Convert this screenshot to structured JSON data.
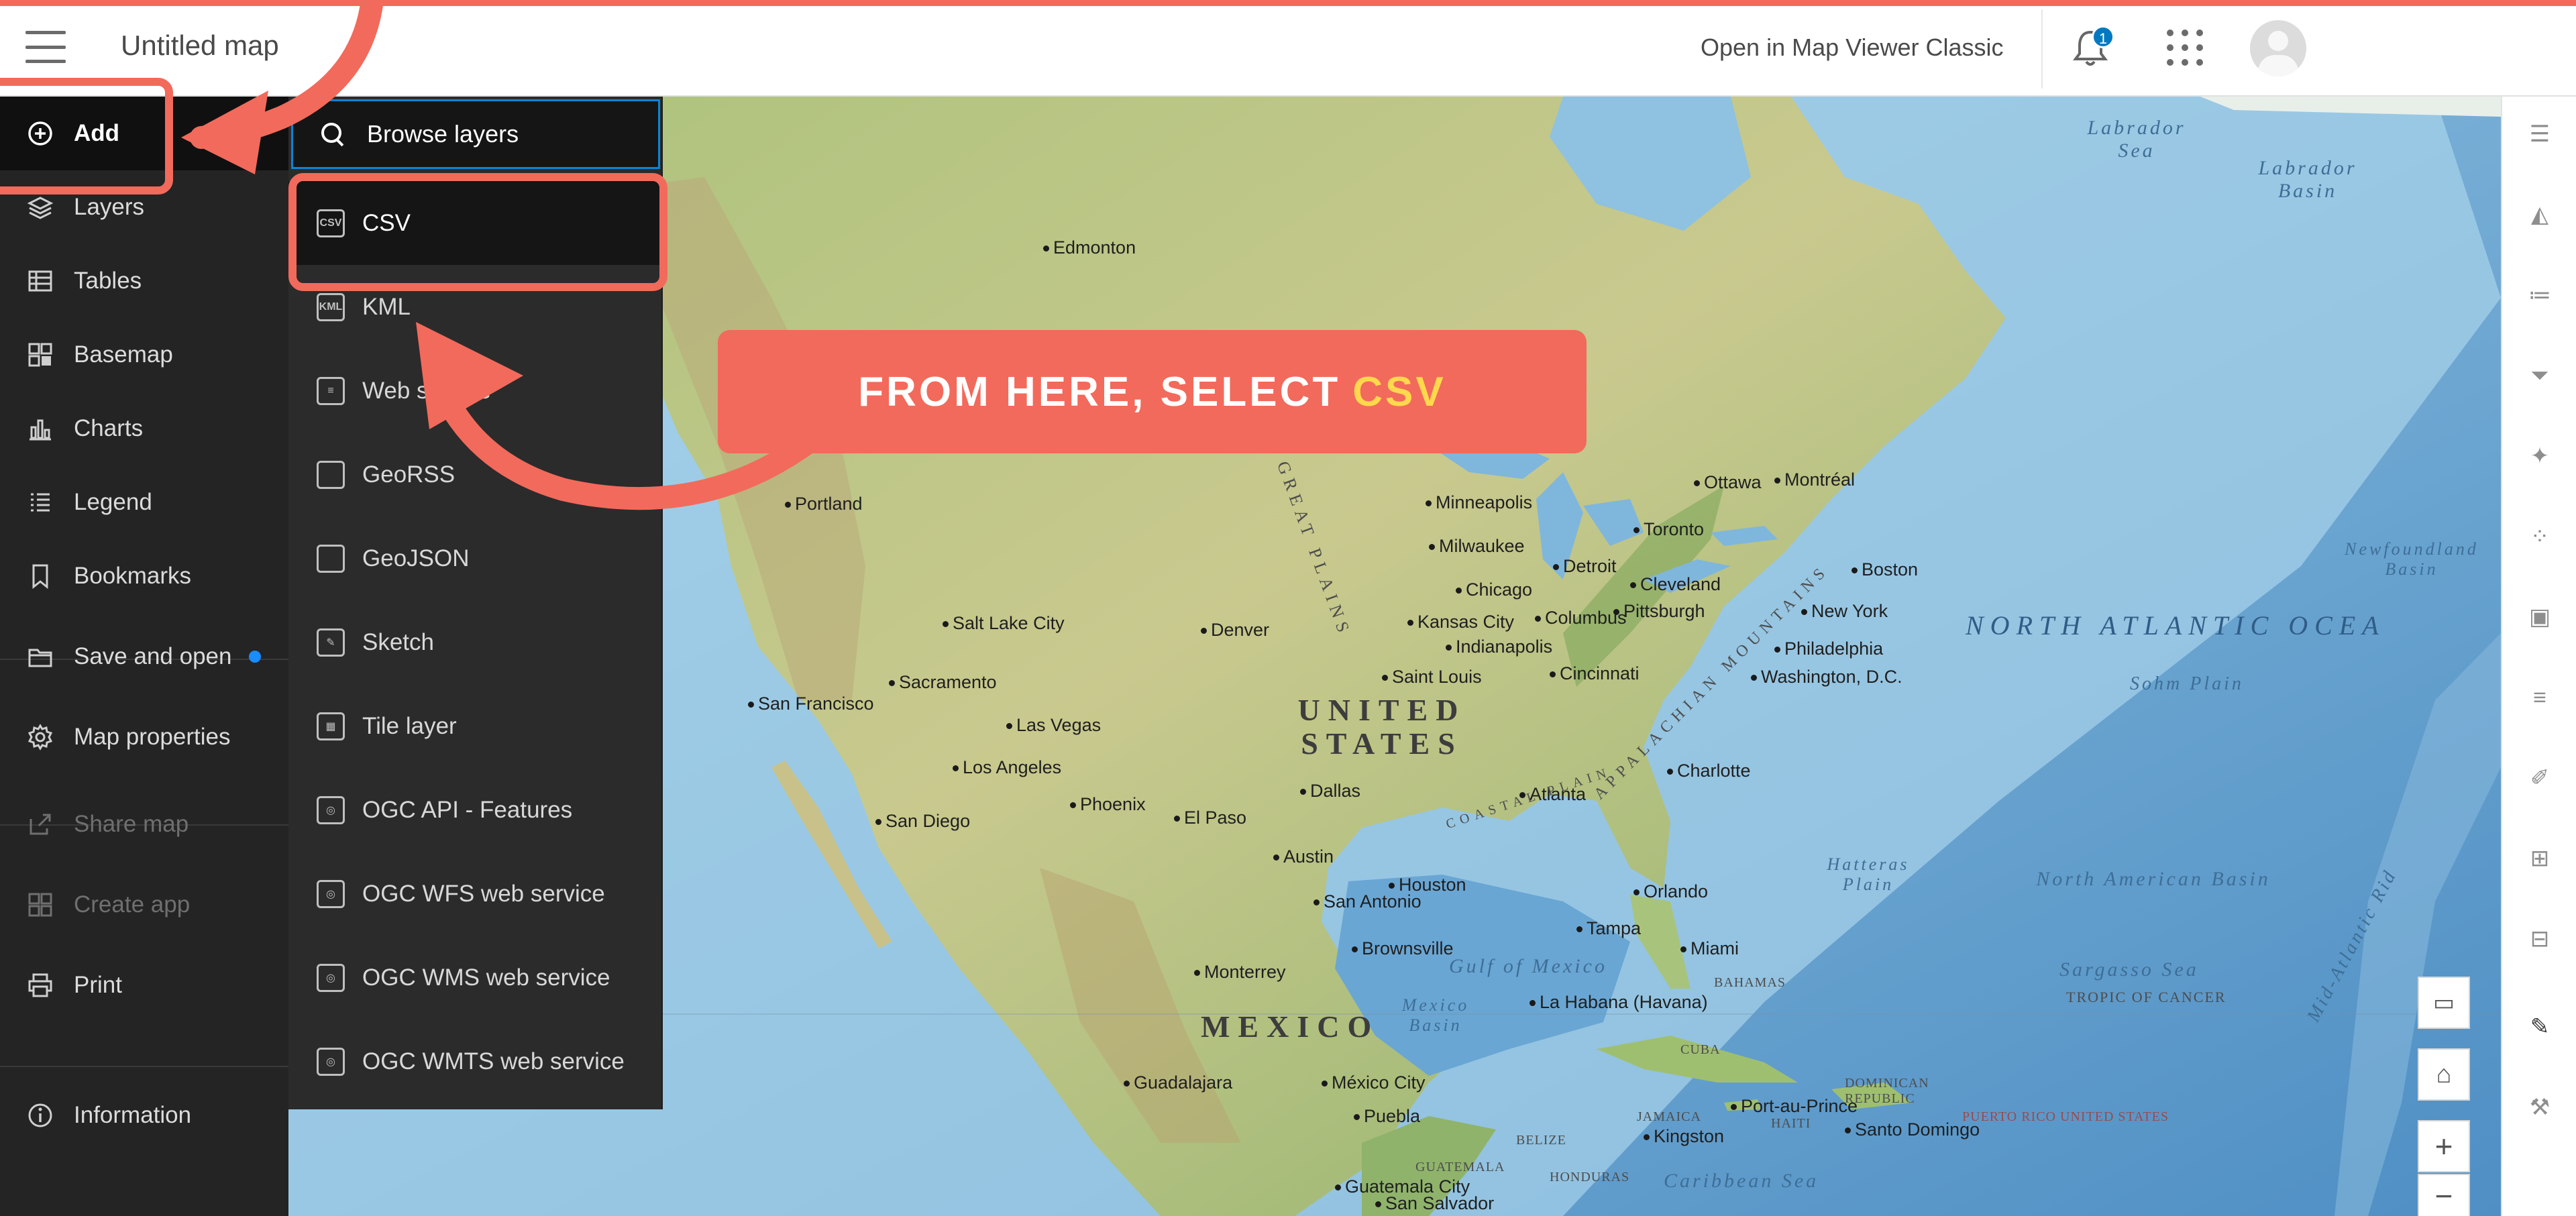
{
  "header": {
    "title": "Untitled map",
    "open_classic": "Open in Map Viewer Classic",
    "notification_count": "1"
  },
  "sidebar": {
    "items": [
      {
        "label": "Add",
        "icon": "plus-circle-icon"
      },
      {
        "label": "Layers",
        "icon": "layers-icon"
      },
      {
        "label": "Tables",
        "icon": "table-icon"
      },
      {
        "label": "Basemap",
        "icon": "basemap-icon"
      },
      {
        "label": "Charts",
        "icon": "chart-icon"
      },
      {
        "label": "Legend",
        "icon": "legend-icon"
      },
      {
        "label": "Bookmarks",
        "icon": "bookmark-icon"
      },
      {
        "label": "Save and open",
        "icon": "folder-icon"
      },
      {
        "label": "Map properties",
        "icon": "gear-icon"
      },
      {
        "label": "Share map",
        "icon": "share-icon"
      },
      {
        "label": "Create app",
        "icon": "create-app-icon"
      },
      {
        "label": "Print",
        "icon": "print-icon"
      },
      {
        "label": "Information",
        "icon": "info-icon"
      }
    ]
  },
  "add_panel": {
    "browse_label": "Browse layers",
    "items": [
      {
        "label": "CSV",
        "icon": "csv-file-icon"
      },
      {
        "label": "KML",
        "icon": "kml-file-icon"
      },
      {
        "label": "Web service",
        "icon": "table-icon"
      },
      {
        "label": "GeoRSS",
        "icon": "layer-icon"
      },
      {
        "label": "GeoJSON",
        "icon": "layer-icon"
      },
      {
        "label": "Sketch",
        "icon": "sketch-icon"
      },
      {
        "label": "Tile layer",
        "icon": "tile-icon"
      },
      {
        "label": "OGC API - Features",
        "icon": "ogc-icon"
      },
      {
        "label": "OGC WFS web service",
        "icon": "ogc-icon"
      },
      {
        "label": "OGC WMS web service",
        "icon": "ogc-icon"
      },
      {
        "label": "OGC WMTS web service",
        "icon": "ogc-icon"
      }
    ]
  },
  "callout": {
    "text": "FROM HERE, SELECT",
    "highlight": "CSV"
  },
  "map": {
    "labels": {
      "edmonton": "Edmonton",
      "portland": "Portland",
      "sacramento": "Sacramento",
      "san_francisco": "San Francisco",
      "salt_lake_city": "Salt Lake City",
      "las_vegas": "Las Vegas",
      "los_angeles": "Los Angeles",
      "san_diego": "San Diego",
      "phoenix": "Phoenix",
      "el_paso": "El Paso",
      "denver": "Denver",
      "minneapolis": "Minneapolis",
      "milwaukee": "Milwaukee",
      "chicago": "Chicago",
      "detroit": "Detroit",
      "toronto": "Toronto",
      "ottawa": "Ottawa",
      "montreal": "Montréal",
      "boston": "Boston",
      "new_york": "New York",
      "philadelphia": "Philadelphia",
      "washington": "Washington, D.C.",
      "cleveland": "Cleveland",
      "pittsburgh": "Pittsburgh",
      "columbus": "Columbus",
      "indianapolis": "Indianapolis",
      "cincinnati": "Cincinnati",
      "kansas_city": "Kansas City",
      "saint_louis": "Saint Louis",
      "dallas": "Dallas",
      "austin": "Austin",
      "houston": "Houston",
      "san_antonio": "San Antonio",
      "atlanta": "Atlanta",
      "charlotte": "Charlotte",
      "orlando": "Orlando",
      "tampa": "Tampa",
      "miami": "Miami",
      "brownsville": "Brownsville",
      "monterrey": "Monterrey",
      "guadalajara": "Guadalajara",
      "mexico_city": "México City",
      "puebla": "Puebla",
      "la_habana": "La Habana (Havana)",
      "port_au_prince": "Port-au-Prince",
      "kingston": "Kingston",
      "santo_domingo": "Santo Domingo",
      "guatemala_city": "Guatemala City",
      "san_salvador": "San Salvador",
      "united_states": "UNITED STATES",
      "mexico": "MEXICO",
      "north_atlantic": "NORTH ATLANTIC OCEA",
      "labrador_sea": "Labrador Sea",
      "labrador_basin": "Labrador Basin",
      "newfoundland_basin": "Newfoundland Basin",
      "sohm_plain": "Sohm Plain",
      "hatteras_plain": "Hatteras Plain",
      "north_american_basin": "North American Basin",
      "sargasso_sea": "Sargasso Sea",
      "tropic_of_cancer": "TROPIC OF CANCER",
      "gulf_of_mexico": "Gulf of Mexico",
      "mexico_basin": "Mexico Basin",
      "caribbean_sea": "Caribbean Sea",
      "mid_atlantic": "Mid-Atlantic Rid",
      "great_plains": "GREAT PLAINS",
      "appalachian": "APPALACHIAN MOUNTAINS",
      "coastal_plain": "COASTAL PLAIN",
      "bahamas": "BAHAMAS",
      "cuba": "CUBA",
      "jamaica": "JAMAICA",
      "haiti": "HAITI",
      "dominican_republic": "DOMINICAN REPUBLIC",
      "puerto_rico": "PUERTO RICO UNITED STATES",
      "belize": "BELIZE",
      "guatemala": "GUATEMALA",
      "honduras": "HONDURAS"
    }
  },
  "right_toolbar": {
    "icons": [
      "properties-icon",
      "styles-icon",
      "fields-icon",
      "filter-icon",
      "effects-icon",
      "clustering-icon",
      "popups-icon",
      "labels-icon",
      "edit-icon",
      "analysis-icon",
      "forms-icon",
      "sketch-icon",
      "configure-icon"
    ]
  },
  "colors": {
    "accent": "#f26a5b",
    "highlight": "#ffd84d",
    "sidebar_bg": "#242424",
    "focus_blue": "#0a84d6"
  }
}
